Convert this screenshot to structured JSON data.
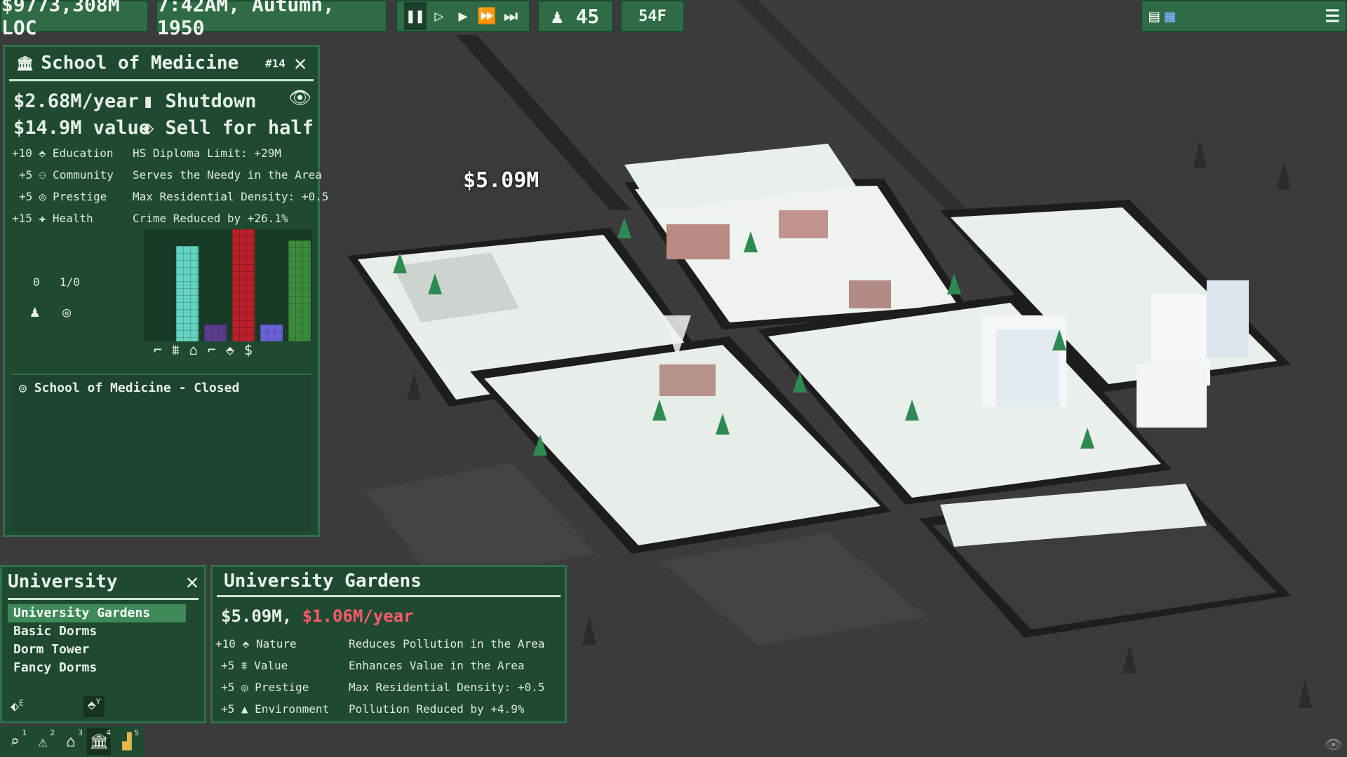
{
  "topbar": {
    "money": "$9773,308M LOC",
    "datetime": "7:42AM, Autumn, 1950",
    "population": "45",
    "temperature": "54F"
  },
  "map": {
    "floating_price": "$5.09M"
  },
  "building_panel": {
    "title": "School of Medicine",
    "id": "#14",
    "income": "$2.68M/year",
    "value": "$14.9M value",
    "shutdown_label": "Shutdown",
    "sell_label": "Sell for half",
    "effects": [
      {
        "amount": "+10",
        "name": "Education",
        "desc": "HS Diploma Limit: +29M",
        "icon": "mortarboard-icon"
      },
      {
        "amount": "+5",
        "name": "Community",
        "desc": "Serves the Needy in the Area",
        "icon": "community-icon"
      },
      {
        "amount": "+5",
        "name": "Prestige",
        "desc": "Max Residential Density: +0.5",
        "icon": "prestige-icon"
      },
      {
        "amount": "+15",
        "name": "Health",
        "desc": "Crime Reduced by +26.1%",
        "icon": "plus-icon"
      }
    ],
    "workers": "0",
    "capacity": "1/0",
    "status_line": "School of Medicine - Closed",
    "bars": [
      {
        "icon": "road-icon",
        "fill": 0.0,
        "color": "#2f6b46"
      },
      {
        "icon": "land-value-icon",
        "fill": 0.85,
        "color": "#64d3c2"
      },
      {
        "icon": "density-icon",
        "fill": 0.15,
        "color": "#5a3d8c"
      },
      {
        "icon": "crime-icon",
        "fill": 1.0,
        "color": "#b8202a"
      },
      {
        "icon": "education-icon",
        "fill": 0.15,
        "color": "#6b62d8"
      },
      {
        "icon": "wealth-icon",
        "fill": 0.9,
        "color": "#3c8a3c"
      }
    ],
    "yellow_bar": {
      "fill": 0.1,
      "color": "#e6c94a"
    }
  },
  "university_panel": {
    "title": "University",
    "items": [
      "University Gardens",
      "Basic Dorms",
      "Dorm Tower",
      "Fancy Dorms"
    ],
    "selected": 0,
    "hotkeys": [
      "E",
      "Y"
    ]
  },
  "detail_panel": {
    "title": "University Gardens",
    "price": "$5.09M,",
    "upkeep": "$1.06M/year",
    "effects": [
      {
        "amount": "+10",
        "name": "Nature",
        "desc": "Reduces Pollution in the Area",
        "icon": "leaf-icon"
      },
      {
        "amount": "+5",
        "name": "Value",
        "desc": "Enhances Value in the Area",
        "icon": "value-icon"
      },
      {
        "amount": "+5",
        "name": "Prestige",
        "desc": "Max Residential Density: +0.5",
        "icon": "prestige-icon"
      },
      {
        "amount": "+5",
        "name": "Environment",
        "desc": "Pollution Reduced by +4.9%",
        "icon": "tree-icon"
      }
    ]
  },
  "toolbar": {
    "tools": [
      {
        "name": "query-tool",
        "key": "1"
      },
      {
        "name": "alert-tool",
        "key": "2"
      },
      {
        "name": "zone-tool",
        "key": "3"
      },
      {
        "name": "amenity-tool",
        "key": "4"
      },
      {
        "name": "build-tool",
        "key": "5"
      }
    ]
  },
  "colors": {
    "panel": "#1f4a31",
    "panel_border": "#2f7049",
    "selected": "#3f8a58",
    "upkeep_red": "#ff5a6a",
    "ground": "#3b3b3b"
  }
}
